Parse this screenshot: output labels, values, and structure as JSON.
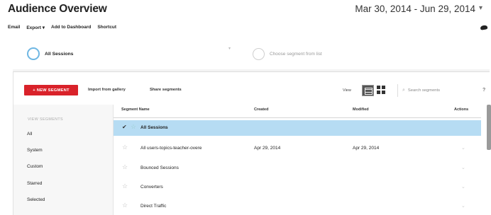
{
  "header": {
    "title": "Audience Overview",
    "date_range": "Mar 30, 2014 - Jun 29, 2014",
    "date_caret": "▾"
  },
  "actions": [
    "Email",
    "Export ▾",
    "Add to Dashboard",
    "Shortcut"
  ],
  "segment_slots": {
    "active": "All Sessions",
    "empty": "Choose segment from list",
    "caret": "▾"
  },
  "toolbar": {
    "new_segment": "+ NEW SEGMENT",
    "import_gallery": "Import from gallery",
    "share_segments": "Share segments",
    "view_label": "View",
    "search_placeholder": "Search segments",
    "help": "?"
  },
  "sidebar": {
    "header": "VIEW SEGMENTS",
    "items": [
      "All",
      "System",
      "Custom",
      "Starred",
      "Selected"
    ]
  },
  "table": {
    "columns": [
      "Segment Name",
      "Created",
      "Modified",
      "Actions"
    ],
    "rows": [
      {
        "name": "All Sessions",
        "created": "",
        "modified": "",
        "selected": true
      },
      {
        "name": "All users-topics-teacher-overe",
        "created": "Apr 29, 2014",
        "modified": "Apr 29, 2014",
        "selected": false
      },
      {
        "name": "Bounced Sessions",
        "created": "",
        "modified": "",
        "selected": false
      },
      {
        "name": "Converters",
        "created": "",
        "modified": "",
        "selected": false
      },
      {
        "name": "Direct Traffic",
        "created": "",
        "modified": "",
        "selected": false
      }
    ]
  },
  "colors": {
    "accent_red": "#d9222a",
    "selection_blue": "#b6dcf3",
    "segment_ring": "#6fb7e3"
  }
}
